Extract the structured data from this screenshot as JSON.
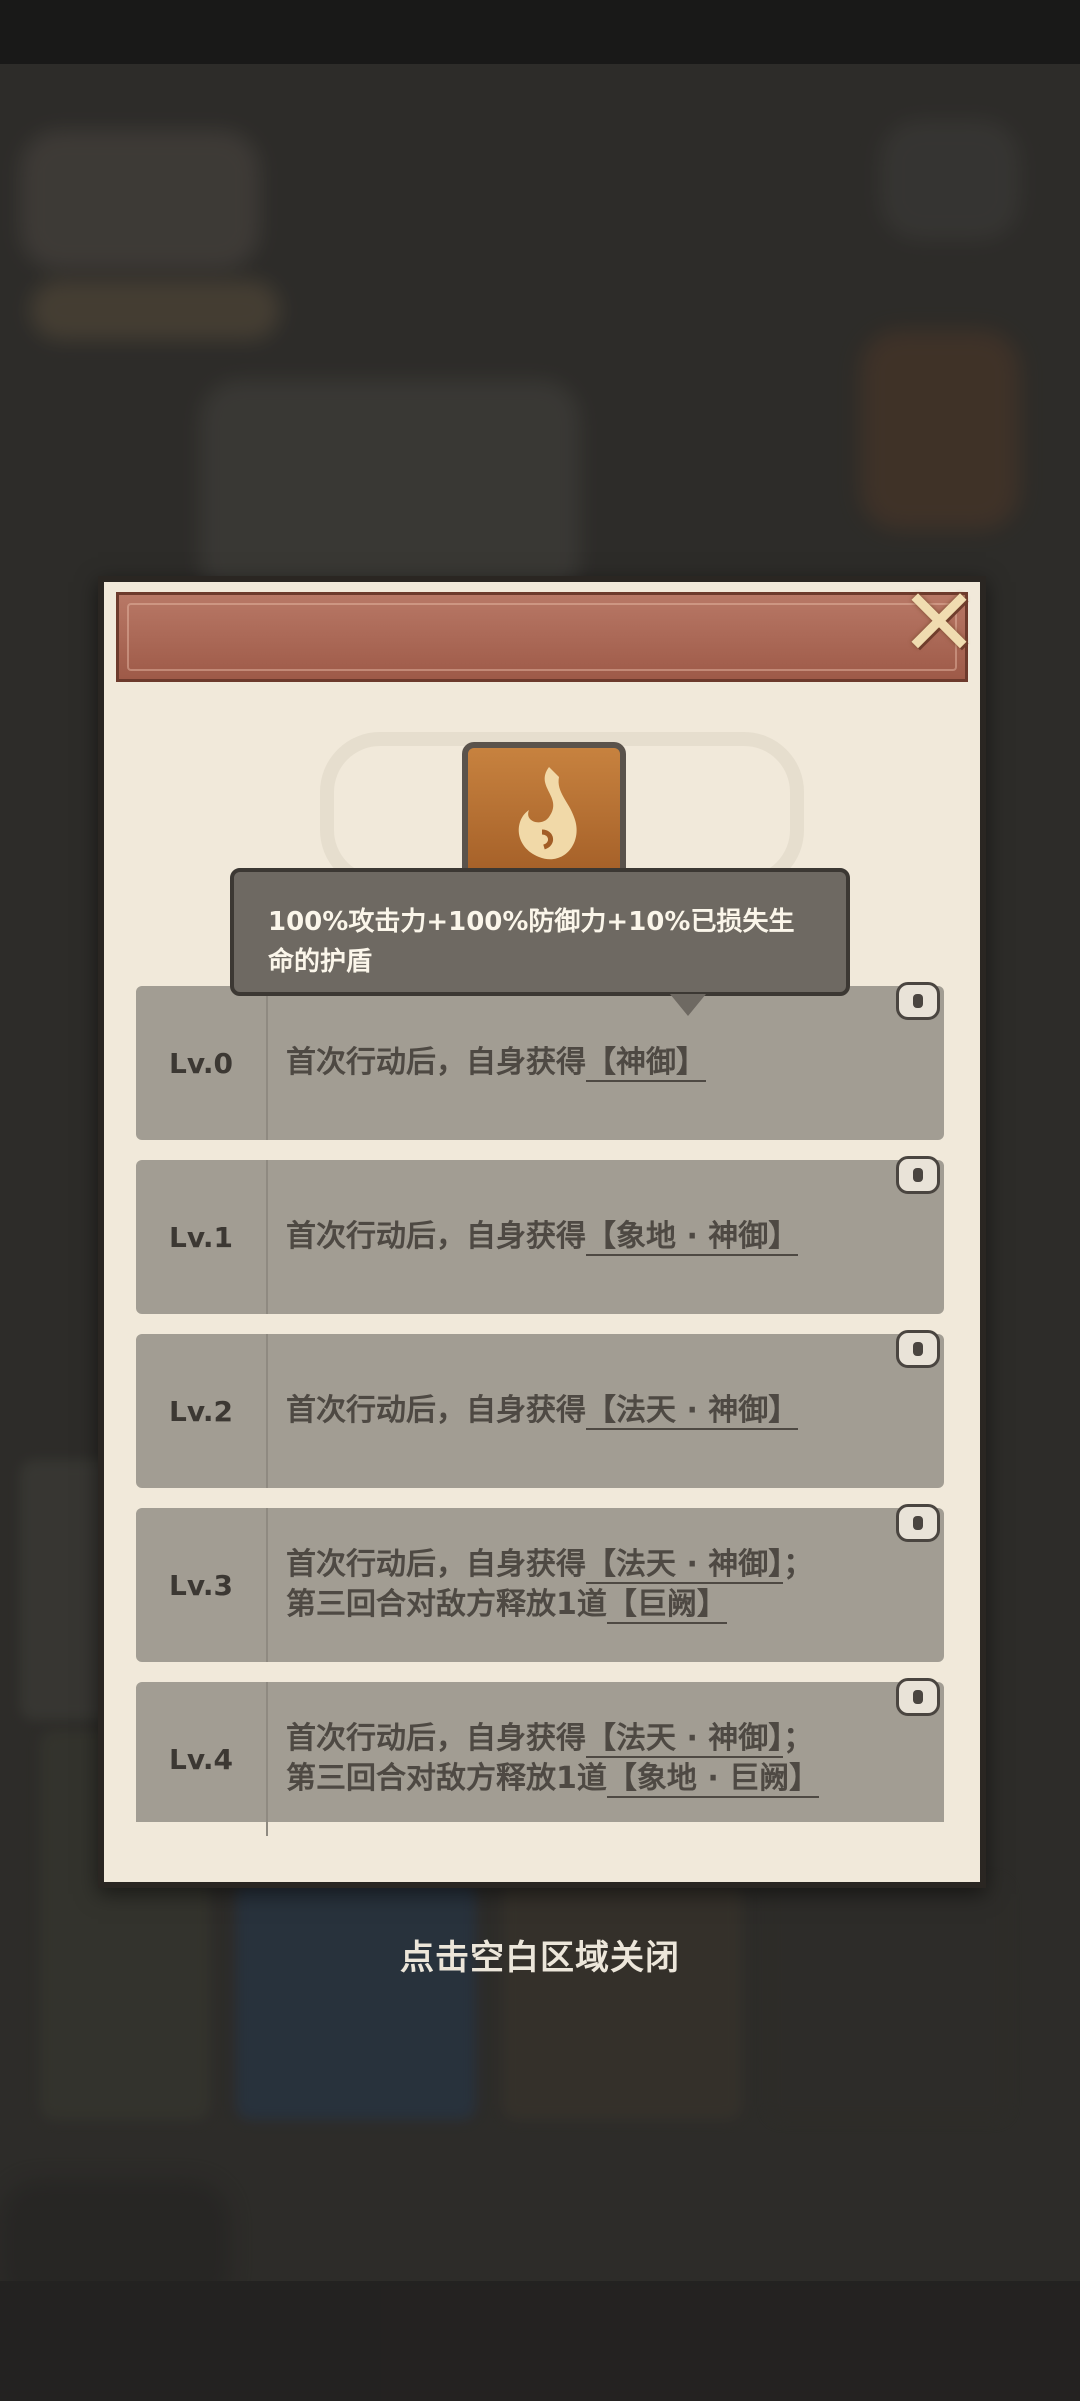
{
  "tooltip": {
    "text": "100%攻击力+100%防御力+10%已损失生命的护盾"
  },
  "levels": [
    {
      "label": "Lv.0",
      "line1": "首次行动后，自身获得",
      "tag1": "【神御】",
      "line2": "",
      "tag2": ""
    },
    {
      "label": "Lv.1",
      "line1": "首次行动后，自身获得",
      "tag1": "【象地 · 神御】",
      "line2": "",
      "tag2": ""
    },
    {
      "label": "Lv.2",
      "line1": "首次行动后，自身获得",
      "tag1": "【法天 · 神御】",
      "line2": "",
      "tag2": ""
    },
    {
      "label": "Lv.3",
      "line1": "首次行动后，自身获得",
      "tag1": "【法天 · 神御】",
      "suffix1": "；",
      "line2": "第三回合对敌方释放1道",
      "tag2": "【巨阙】"
    },
    {
      "label": "Lv.4",
      "line1": "首次行动后，自身获得",
      "tag1": "【法天 · 神御】",
      "suffix1": "；",
      "line2": "第三回合对敌方释放1道",
      "tag2": "【象地 · 巨阙】"
    }
  ],
  "hint": "点击空白区域关闭",
  "icons": {
    "close": "close-icon",
    "lock": "lock-icon",
    "skill": "flame-skill-icon"
  },
  "colors": {
    "header": "#a8614f",
    "panel": "#f1e9da",
    "row": "#a29d93",
    "tooltip": "#6e6962"
  }
}
